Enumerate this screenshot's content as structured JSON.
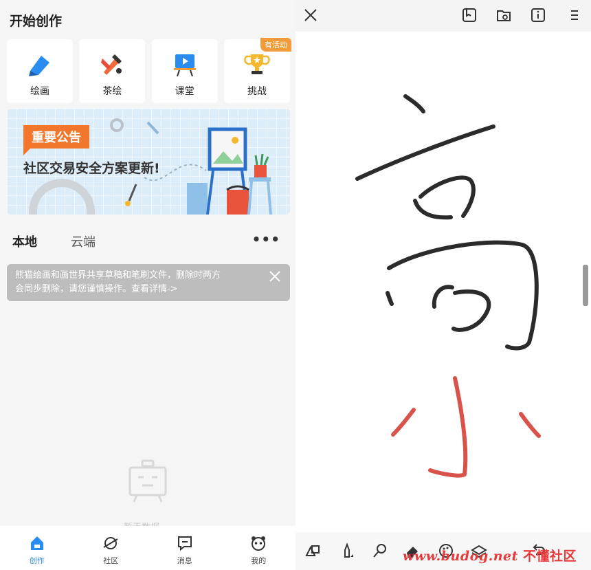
{
  "left_panel": {
    "section_title": "开始创作",
    "tiles": [
      {
        "label": "绘画",
        "icon": "pen-icon"
      },
      {
        "label": "茶绘",
        "icon": "brush-icon"
      },
      {
        "label": "课堂",
        "icon": "classroom-icon"
      },
      {
        "label": "挑战",
        "icon": "trophy-icon",
        "badge": "有活动"
      }
    ],
    "banner": {
      "tag": "重要公告",
      "headline": "社区交易安全方案更新!"
    },
    "tabs": {
      "local": "本地",
      "cloud": "云端",
      "more": "•••"
    },
    "notice": {
      "line1": "熊猫绘画和画世界共享草稿和笔刷文件，删除时两方",
      "line2": "会同步删除，请您谨慎操作。查看详情->"
    },
    "empty_state": "暂无数据",
    "bottom_nav": [
      {
        "label": "创作",
        "icon": "create-icon",
        "active": true
      },
      {
        "label": "社区",
        "icon": "planet-icon",
        "active": false
      },
      {
        "label": "消息",
        "icon": "message-icon",
        "active": false
      },
      {
        "label": "我的",
        "icon": "panda-icon",
        "active": false
      }
    ]
  },
  "right_panel": {
    "toolbar_icons": [
      "shapes-icon",
      "pencil-icon",
      "brush-icon",
      "eraser-icon",
      "palette-icon",
      "layers-icon",
      "undo-icon"
    ],
    "top_icons": [
      "close-icon",
      "bookmark-icon",
      "folder-icon",
      "info-icon",
      "menu-icon"
    ],
    "stroke_colors": {
      "dark": "#2b2b2b",
      "red": "#d9534a"
    }
  },
  "watermark": {
    "url": "www.budog.net",
    "site": "不懂社区"
  },
  "colors": {
    "accent": "#2a8cf0",
    "badge": "#f39b38",
    "announcement": "#f2772d"
  }
}
